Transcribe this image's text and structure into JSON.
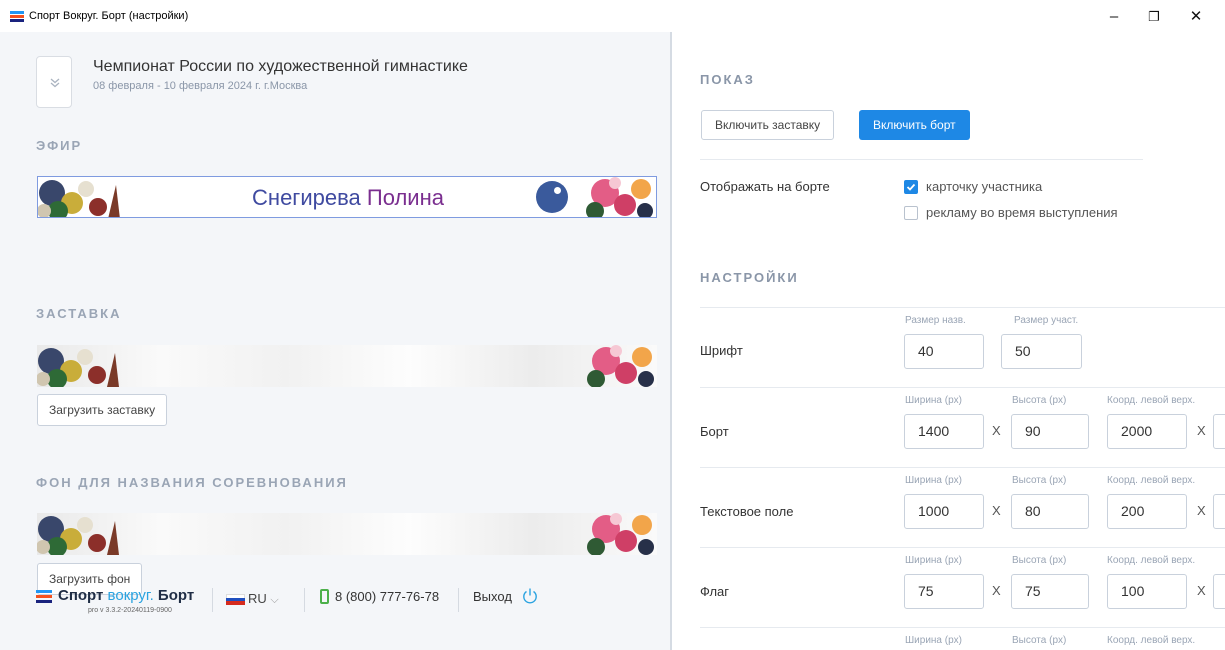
{
  "window": {
    "title": "Спорт Вокруг. Борт (настройки)",
    "minimize_glyph": "–",
    "restore_glyph": "❐",
    "close_glyph": "✕"
  },
  "event": {
    "title": "Чемпионат России по художественной гимнастике",
    "date": "08 февраля - 10 февраля 2024 г. г.Москва"
  },
  "efir": {
    "heading": "ЭФИР",
    "first_name": "Снегирева",
    "last_name": "Полина"
  },
  "zastavka": {
    "heading": "ЗАСТАВКА",
    "upload_label": "Загрузить заставку"
  },
  "fon": {
    "heading": "ФОН ДЛЯ НАЗВАНИЯ СОРЕВНОВАНИЯ",
    "upload_label": "Загрузить фон"
  },
  "footer": {
    "brand_a": "Спорт",
    "brand_b": "вокруг.",
    "brand_c": "Борт",
    "version": "pro v 3.3.2-20240119-0900",
    "lang": "RU",
    "lang_chevron": "⌵",
    "phone": "8 (800) 777-76-78",
    "logout": "Выход"
  },
  "show": {
    "heading": "ПОКАЗ",
    "btn_splash": "Включить заставку",
    "btn_board": "Включить борт",
    "display_label": "Отображать на борте",
    "options": [
      {
        "label": "карточку участника",
        "checked": true
      },
      {
        "label": "рекламу во время выступления",
        "checked": false
      }
    ]
  },
  "settings": {
    "heading": "НАСТРОЙКИ",
    "font": {
      "label": "Шрифт",
      "cap_name": "Размер назв.",
      "cap_part": "Размер участ.",
      "val_name": "40",
      "val_part": "50"
    },
    "rows": [
      {
        "label": "Борт",
        "cap_w": "Ширина (px)",
        "cap_h": "Высота (px)",
        "cap_c": "Коорд. левой верх.",
        "w": "1400",
        "h": "90",
        "c": "2000"
      },
      {
        "label": "Текстовое поле",
        "cap_w": "Ширина (px)",
        "cap_h": "Высота (px)",
        "cap_c": "Коорд. левой верх.",
        "w": "1000",
        "h": "80",
        "c": "200"
      },
      {
        "label": "Флаг",
        "cap_w": "Ширина (px)",
        "cap_h": "Высота (px)",
        "cap_c": "Коорд. левой верх.",
        "w": "75",
        "h": "75",
        "c": "100"
      },
      {
        "cap_w": "Ширина (px)",
        "cap_h": "Высота (px)",
        "cap_c": "Коорд. левой верх."
      }
    ],
    "times": "X"
  },
  "colors": {
    "accent": "#1e88e5",
    "brand_blue": "#2aa3e0",
    "brand_dark": "#1f2d45",
    "name_blue": "#3f4aa0",
    "name_purple": "#7a2e8f",
    "phone_green": "#4cb04a"
  }
}
